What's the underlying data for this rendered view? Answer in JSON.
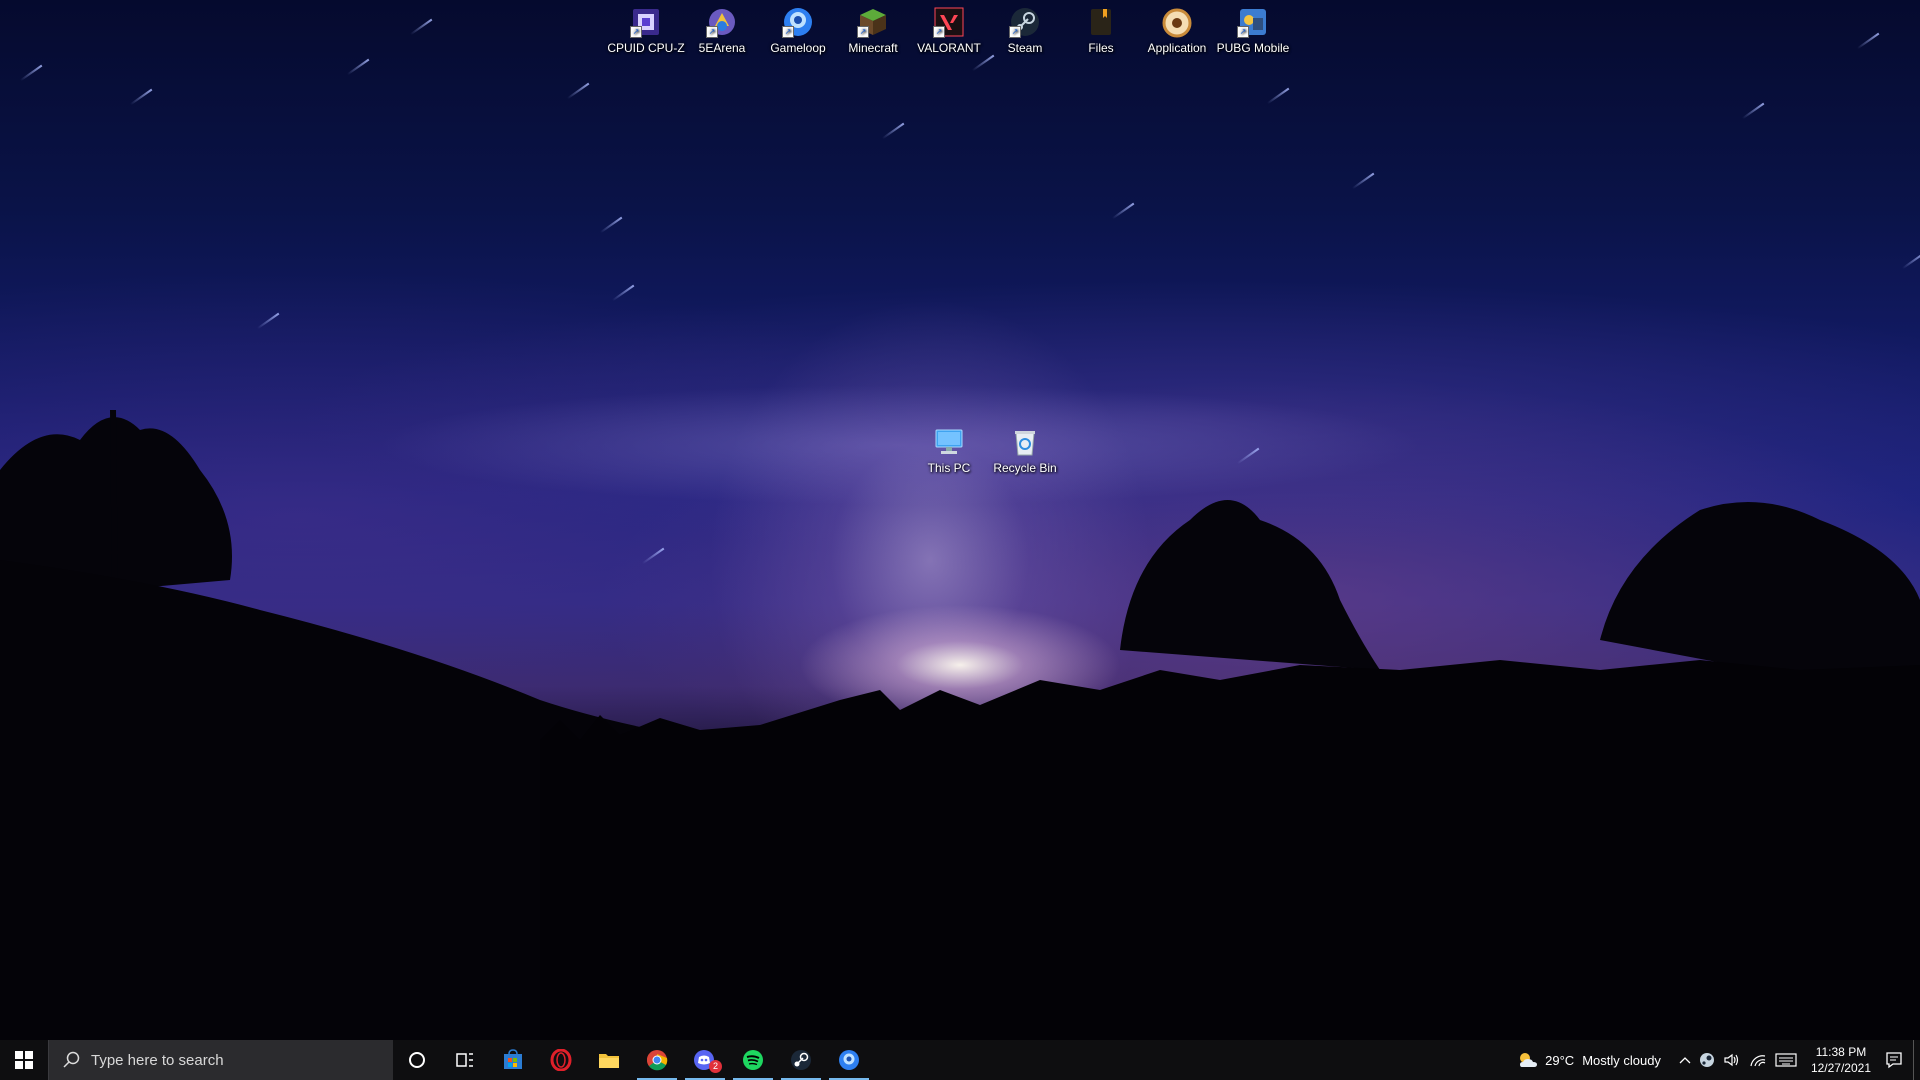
{
  "desktop": {
    "top_icons": [
      {
        "label": "CPUID CPU-Z",
        "icon": "cpu-z-icon"
      },
      {
        "label": "5EArena",
        "icon": "5earena-icon"
      },
      {
        "label": "Gameloop",
        "icon": "gameloop-icon"
      },
      {
        "label": "Minecraft",
        "icon": "minecraft-icon"
      },
      {
        "label": "VALORANT",
        "icon": "valorant-icon"
      },
      {
        "label": "Steam",
        "icon": "steam-icon"
      },
      {
        "label": "Files",
        "icon": "files-icon"
      },
      {
        "label": "Application",
        "icon": "application-icon"
      },
      {
        "label": "PUBG Mobile",
        "icon": "pubg-mobile-icon"
      }
    ],
    "center_icons": [
      {
        "label": "This PC",
        "icon": "this-pc-icon"
      },
      {
        "label": "Recycle Bin",
        "icon": "recycle-bin-icon"
      }
    ]
  },
  "taskbar": {
    "search_placeholder": "Type here to search",
    "pinned": [
      {
        "name": "microsoft-store-icon",
        "active": false
      },
      {
        "name": "opera-icon",
        "active": false
      },
      {
        "name": "file-explorer-icon",
        "active": false
      },
      {
        "name": "chrome-icon",
        "active": true
      },
      {
        "name": "discord-icon",
        "active": true,
        "badge": "2"
      },
      {
        "name": "spotify-icon",
        "active": true
      },
      {
        "name": "steam-icon",
        "active": true
      },
      {
        "name": "gameloop-icon",
        "active": true
      }
    ],
    "weather": {
      "temp": "29°C",
      "condition": "Mostly cloudy"
    },
    "clock": {
      "time": "11:38 PM",
      "date": "12/27/2021"
    }
  },
  "colors": {
    "taskbar_bg": "#0e0e10",
    "search_bg": "#2b2b2e",
    "active_indicator": "#76b9ed"
  }
}
